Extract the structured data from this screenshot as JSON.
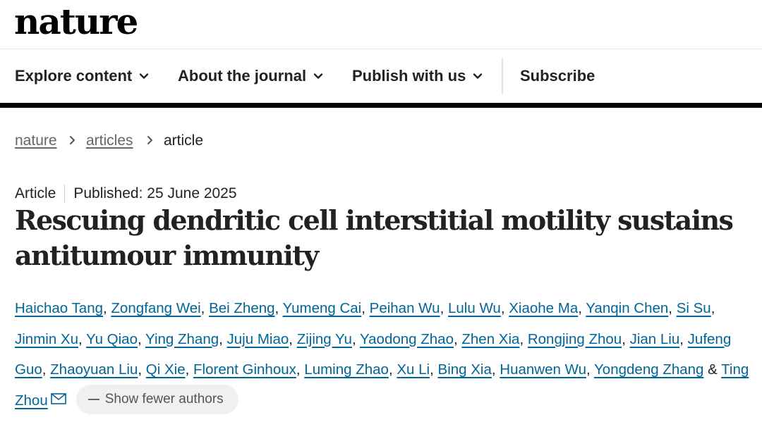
{
  "logo": "nature",
  "nav": {
    "explore": "Explore content",
    "about": "About the journal",
    "publish": "Publish with us",
    "subscribe": "Subscribe"
  },
  "breadcrumb": [
    "nature",
    "articles",
    "article"
  ],
  "article": {
    "type": "Article",
    "published": "Published: 25 June 2025",
    "title": "Rescuing dendritic cell interstitial motility sustains antitumour immunity"
  },
  "authors": [
    "Haichao Tang",
    "Zongfang Wei",
    "Bei Zheng",
    "Yumeng Cai",
    "Peihan Wu",
    "Lulu Wu",
    "Xiaohe Ma",
    "Yanqin Chen",
    "Si Su",
    "Jinmin Xu",
    "Yu Qiao",
    "Ying Zhang",
    "Juju Miao",
    "Zijing Yu",
    "Yaodong Zhao",
    "Zhen Xia",
    "Rongjing Zhou",
    "Jian Liu",
    "Jufeng Guo",
    "Zhaoyuan Liu",
    "Qi Xie",
    "Florent Ginhoux",
    "Luming Zhao",
    "Xu Li",
    "Bing Xia",
    "Huanwen Wu",
    "Yongdeng Zhang",
    "Ting Zhou"
  ],
  "author_join": "&",
  "show_fewer": "Show fewer authors"
}
